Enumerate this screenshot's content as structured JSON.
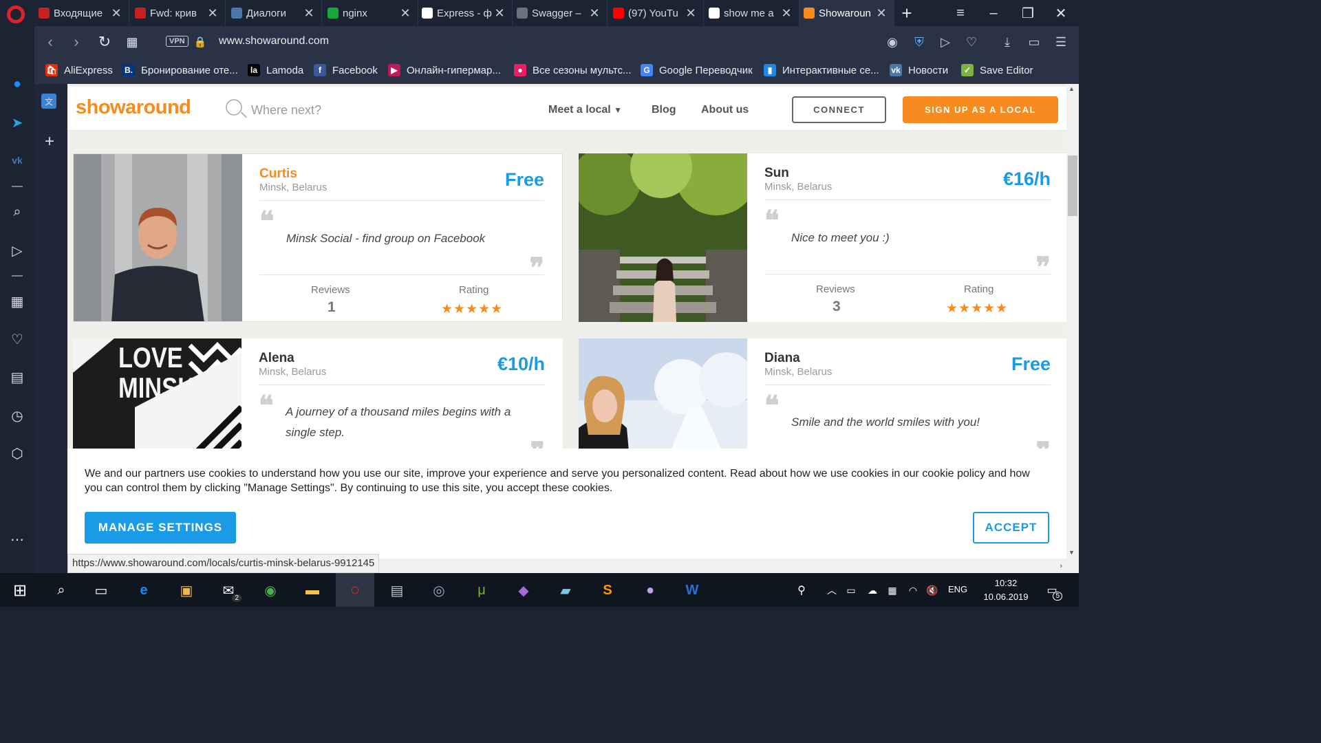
{
  "browser": {
    "tabs": [
      {
        "title": "Входящие",
        "color": "#c5221f",
        "icon": "gmail-icon"
      },
      {
        "title": "Fwd: крив",
        "color": "#c5221f",
        "icon": "gmail-icon"
      },
      {
        "title": "Диалоги",
        "color": "#4a76a8",
        "icon": "chat-icon"
      },
      {
        "title": "nginx",
        "color": "#1aa639",
        "icon": "nginx-icon"
      },
      {
        "title": "Express - ф",
        "color": "#ffffff",
        "icon": "express-icon"
      },
      {
        "title": "Swagger –",
        "color": "#6b7280",
        "icon": "swagger-icon"
      },
      {
        "title": "(97) YouTu",
        "color": "#ff0000",
        "icon": "youtube-icon"
      },
      {
        "title": "show me a",
        "color": "#ffffff",
        "icon": "google-icon"
      },
      {
        "title": "Showaroun",
        "color": "#f68b1f",
        "icon": "showaround-icon"
      }
    ],
    "address": {
      "vpn_label": "VPN",
      "url": "www.showaround.com"
    },
    "bookmarks": [
      {
        "label": "AliExpress",
        "color": "#e62e04",
        "glyph": "🛍"
      },
      {
        "label": "Бронирование оте...",
        "color": "#003580",
        "glyph": "B."
      },
      {
        "label": "Lamoda",
        "color": "#000000",
        "glyph": "la"
      },
      {
        "label": "Facebook",
        "color": "#3b5998",
        "glyph": "f"
      },
      {
        "label": "Онлайн-гипермар...",
        "color": "#c2185b",
        "glyph": "▶"
      },
      {
        "label": "Все сезоны мультс...",
        "color": "#e91e63",
        "glyph": "●"
      },
      {
        "label": "Google Переводчик",
        "color": "#4285f4",
        "glyph": "G"
      },
      {
        "label": "Интерактивные се...",
        "color": "#1e88e5",
        "glyph": "▮"
      },
      {
        "label": "Новости",
        "color": "#4a76a8",
        "glyph": "vk"
      },
      {
        "label": "Save Editor",
        "color": "#7cb342",
        "glyph": "✓"
      }
    ],
    "status_url": "https://www.showaround.com/locals/curtis-minsk-belarus-9912145"
  },
  "site": {
    "logo": "showaround",
    "search_placeholder": "Where next?",
    "nav": {
      "meet_local": "Meet a local",
      "blog": "Blog",
      "about": "About us"
    },
    "connect": "CONNECT",
    "signup": "SIGN UP AS A LOCAL"
  },
  "cards": [
    {
      "name": "Curtis",
      "location": "Minsk, Belarus",
      "price": "Free",
      "quote": "Minsk Social - find group on Facebook",
      "reviews_label": "Reviews",
      "reviews": "1",
      "rating_label": "Rating",
      "rating": 5
    },
    {
      "name": "Sun",
      "location": "Minsk, Belarus",
      "price": "€16/h",
      "quote": "Nice to meet you :)",
      "reviews_label": "Reviews",
      "reviews": "3",
      "rating_label": "Rating",
      "rating": 5
    },
    {
      "name": "Alena",
      "location": "Minsk, Belarus",
      "price": "€10/h",
      "quote": "A journey of a thousand miles begins with a single step.",
      "photo_text": "LOVE MINSK"
    },
    {
      "name": "Diana",
      "location": "Minsk, Belarus",
      "price": "Free",
      "quote": "Smile and the world smiles with you!"
    }
  ],
  "cookie": {
    "text": "We and our partners use cookies to understand how you use our site, improve your experience and serve you personalized content. Read about how we use cookies in our cookie policy and how you can control them by clicking \"Manage Settings\". By continuing to use this site, you accept these cookies.",
    "manage": "MANAGE SETTINGS",
    "accept": "ACCEPT"
  },
  "taskbar": {
    "lang": "ENG",
    "time": "10:32",
    "date": "10.06.2019",
    "mail_badge": "2",
    "notif_badge": "5"
  },
  "colors": {
    "accent_orange": "#f68b1f",
    "accent_blue": "#1a9be6"
  }
}
